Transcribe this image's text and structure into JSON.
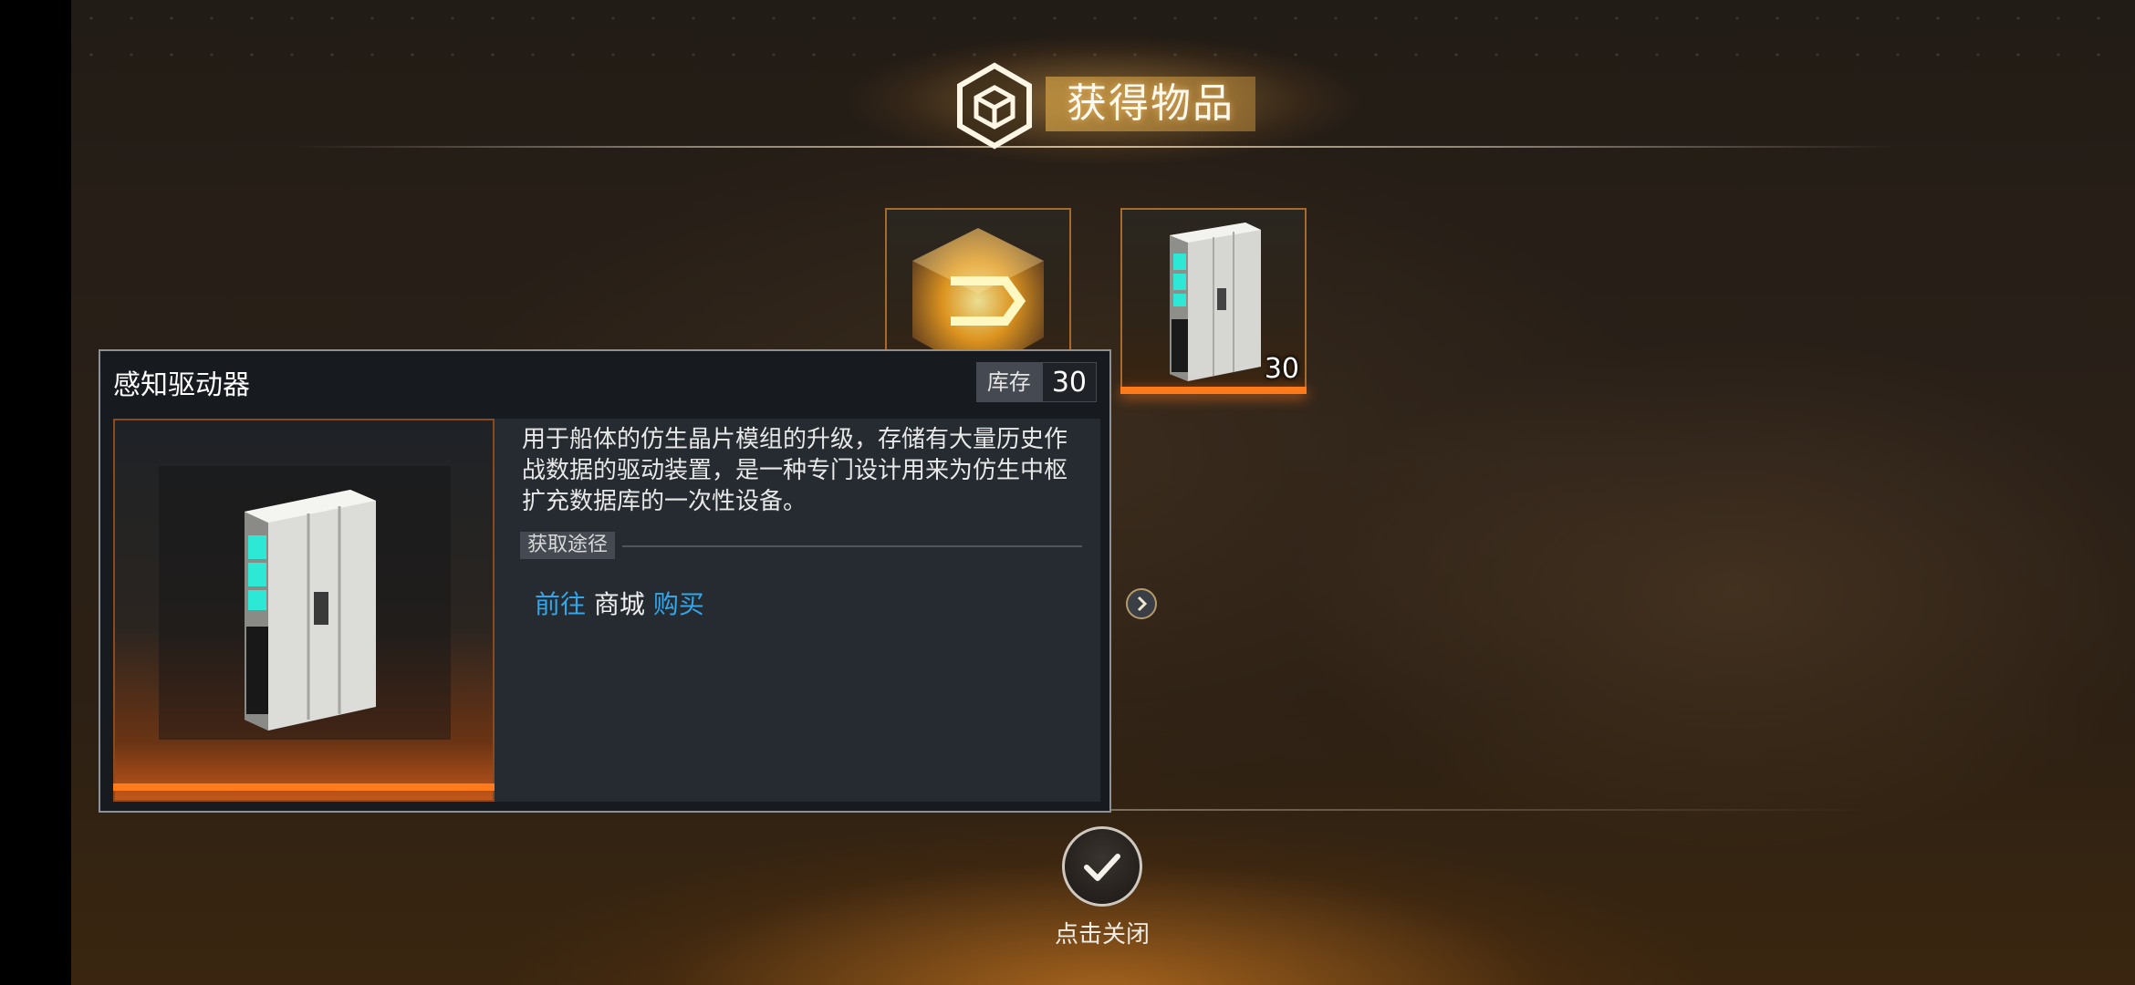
{
  "header": {
    "title": "获得物品",
    "icon": "hex-cube-icon"
  },
  "reward_items": [
    {
      "name": "sensor-driver-cube-item",
      "count": ""
    },
    {
      "name": "sensor-driver-item",
      "count": "30"
    }
  ],
  "panel": {
    "title": "感知驱动器",
    "stock_label": "库存",
    "stock_value": "30",
    "description": "用于船体的仿生晶片模组的升级，存储有大量历史作战数据的驱动装置，是一种专门设计用来为仿生中枢扩充数据库的一次性设备。",
    "route_label": "获取途径",
    "route": {
      "go": "前往",
      "shop": "商城",
      "buy": "购买"
    }
  },
  "close": {
    "label": "点击关闭"
  },
  "colors": {
    "accent_orange": "#ff7a1a",
    "link_blue": "#32a6e8",
    "gold": "#d2a046"
  }
}
